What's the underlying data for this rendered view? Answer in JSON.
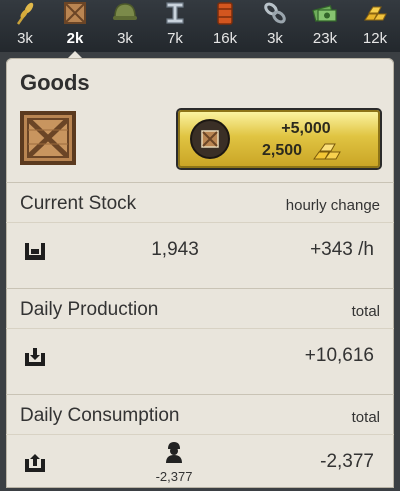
{
  "resources": [
    {
      "icon": "wheat-icon",
      "amount": "3k",
      "active": false
    },
    {
      "icon": "goods-crate-icon",
      "amount": "2k",
      "active": true
    },
    {
      "icon": "helmet-icon",
      "amount": "3k",
      "active": false
    },
    {
      "icon": "steel-beam-icon",
      "amount": "7k",
      "active": false
    },
    {
      "icon": "fuel-barrel-icon",
      "amount": "16k",
      "active": false
    },
    {
      "icon": "chain-icon",
      "amount": "3k",
      "active": false
    },
    {
      "icon": "money-icon",
      "amount": "23k",
      "active": false
    },
    {
      "icon": "gold-bars-icon",
      "amount": "12k",
      "active": false
    }
  ],
  "panel": {
    "title": "Goods",
    "buy": {
      "amount": "+5,000",
      "cost": "2,500",
      "cost_icon": "gold-bars-icon"
    },
    "current_stock": {
      "label": "Current Stock",
      "right_label": "hourly change",
      "value": "1,943",
      "change": "+343 /h",
      "icon": "warehouse-icon"
    },
    "daily_production": {
      "label": "Daily Production",
      "right_label": "total",
      "value": "+10,616",
      "icon": "production-in-icon"
    },
    "daily_consumption": {
      "label": "Daily Consumption",
      "right_label": "total",
      "consumer_value": "-2,377",
      "value": "-2,377",
      "icon": "consumption-out-icon",
      "consumer_icon": "soldier-icon"
    }
  },
  "colors": {
    "panel_bg": "#e9e5dc",
    "bar_bg": "#2b3035",
    "gold_button": "#e0c442"
  }
}
